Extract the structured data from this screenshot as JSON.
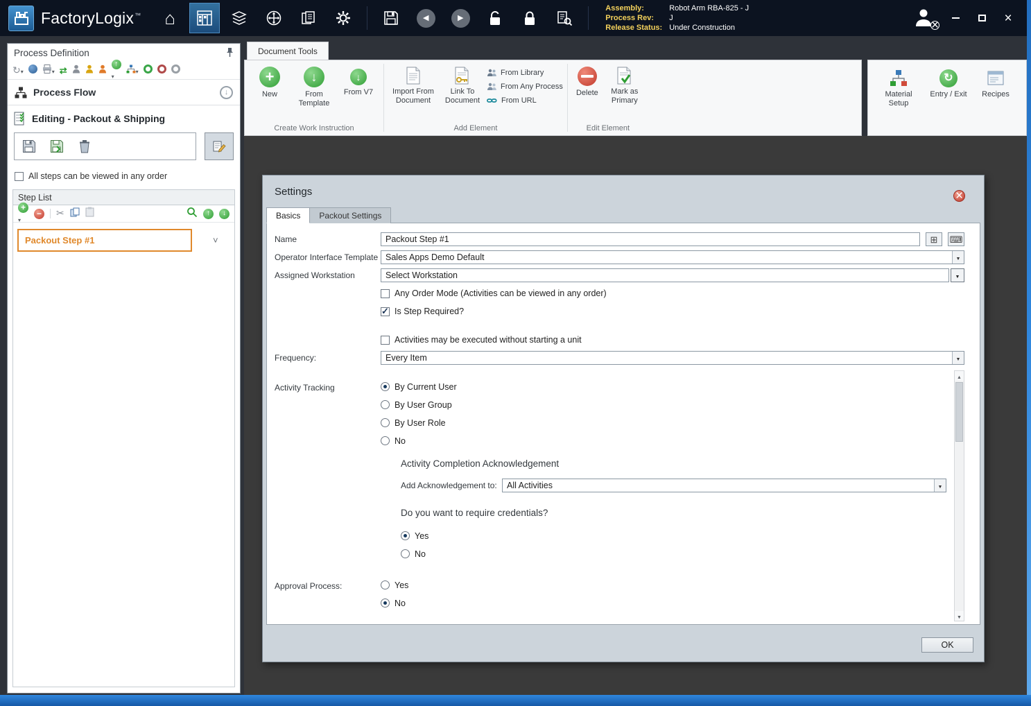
{
  "icons": {
    "app_logo": "blue factory grid badge",
    "home": "house",
    "process_definition": "grid sheet (selected)",
    "materials": "stacked layers",
    "navigate": "compass circle",
    "reports": "document pages",
    "settings": "gear",
    "save": "floppy disk",
    "back": "gray circle left arrow",
    "forward": "gray circle right arrow",
    "unlock": "open padlock",
    "lock": "closed padlock",
    "search": "document with magnifier",
    "user": "person with close badge",
    "minimize": "bar",
    "maximize": "box",
    "close": "x"
  },
  "titlebar": {
    "app_name": "FactoryLogix",
    "trademark": "™",
    "assembly_label": "Assembly:",
    "assembly_value": "Robot Arm RBA-825 - J",
    "process_rev_label": "Process Rev:",
    "process_rev_value": "J",
    "release_status_label": "Release Status:",
    "release_status_value": "Under Construction"
  },
  "sidebar": {
    "title": "Process Definition",
    "process_flow_label": "Process Flow",
    "editing_label": "Editing - Packout & Shipping",
    "order_checkbox_label": "All steps can be viewed in any order",
    "order_checkbox_checked": false,
    "step_list_title": "Step List",
    "steps": [
      {
        "label": "Packout Step #1",
        "selected": true
      }
    ]
  },
  "ribbon": {
    "tab": "Document Tools",
    "create_group": {
      "label": "Create Work Instruction",
      "new": "New",
      "from_template": "From Template",
      "from_v7": "From V7"
    },
    "add_group": {
      "label": "Add Element",
      "import_from_document": "Import From Document",
      "link_to_document": "Link To Document",
      "from_library": "From Library",
      "from_any_process": "From Any Process",
      "from_url": "From URL"
    },
    "edit_group": {
      "label": "Edit Element",
      "delete": "Delete",
      "mark_as_primary": "Mark as Primary"
    },
    "right": {
      "material_setup": "Material Setup",
      "entry_exit": "Entry / Exit",
      "recipes": "Recipes"
    }
  },
  "dialog": {
    "title": "Settings",
    "tabs": {
      "basics": "Basics",
      "packout": "Packout Settings"
    },
    "name_label": "Name",
    "name_value": "Packout Step #1",
    "oit_label": "Operator Interface Template",
    "oit_value": "Sales Apps Demo Default",
    "workstation_label": "Assigned Workstation",
    "workstation_value": "Select Workstation",
    "any_order_label": "Any Order Mode (Activities can be viewed in any order)",
    "any_order_checked": false,
    "step_required_label": "Is Step Required?",
    "step_required_checked": true,
    "no_unit_label": "Activities may be executed without starting a unit",
    "no_unit_checked": false,
    "frequency_label": "Frequency:",
    "frequency_value": "Every Item",
    "activity_tracking_label": "Activity Tracking",
    "tracking_options": [
      "By Current User",
      "By User Group",
      "By User Role",
      "No"
    ],
    "tracking_checked": [
      true,
      false,
      false,
      false
    ],
    "ack_heading": "Activity Completion Acknowledgement",
    "ack_label": "Add Acknowledgement to:",
    "ack_value": "All Activities",
    "credentials_question": "Do you want to require credentials?",
    "credentials_options": [
      "Yes",
      "No"
    ],
    "credentials_checked": [
      true,
      false
    ],
    "approval_label": "Approval Process:",
    "approval_options": [
      "Yes",
      "No"
    ],
    "approval_checked": [
      false,
      true
    ],
    "ok_label": "OK"
  }
}
